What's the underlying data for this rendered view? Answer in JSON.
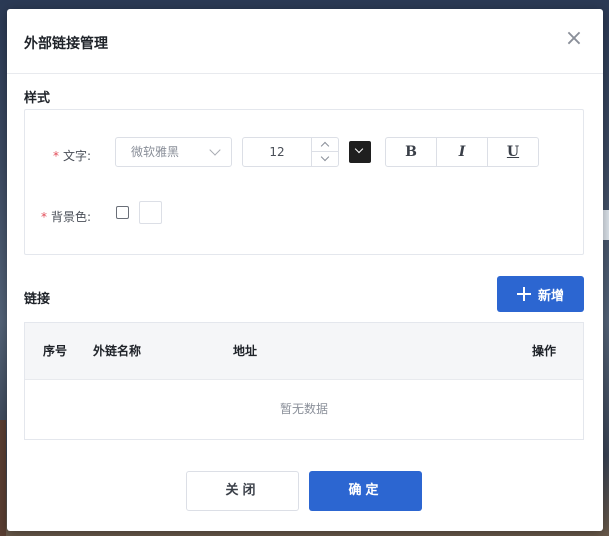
{
  "dialog": {
    "title": "外部链接管理",
    "close_icon": "close-icon"
  },
  "style_section": {
    "label": "样式",
    "text_field": {
      "required_mark": "*",
      "label": "文字:",
      "font_family": "微软雅黑",
      "font_size": "12",
      "color": "#1f1f1f",
      "bold_label": "B",
      "italic_label": "I",
      "underline_label": "U"
    },
    "background_field": {
      "required_mark": "*",
      "label": "背景色:",
      "checked": false,
      "color": "#ffffff"
    }
  },
  "links_section": {
    "label": "链接",
    "add_button_label": "新增",
    "table": {
      "columns": [
        "序号",
        "外链名称",
        "地址",
        "操作"
      ],
      "rows": [],
      "empty_text": "暂无数据"
    }
  },
  "footer": {
    "close_label": "关闭",
    "confirm_label": "确定"
  },
  "colors": {
    "primary": "#2c66d1",
    "required": "#e34d59"
  }
}
